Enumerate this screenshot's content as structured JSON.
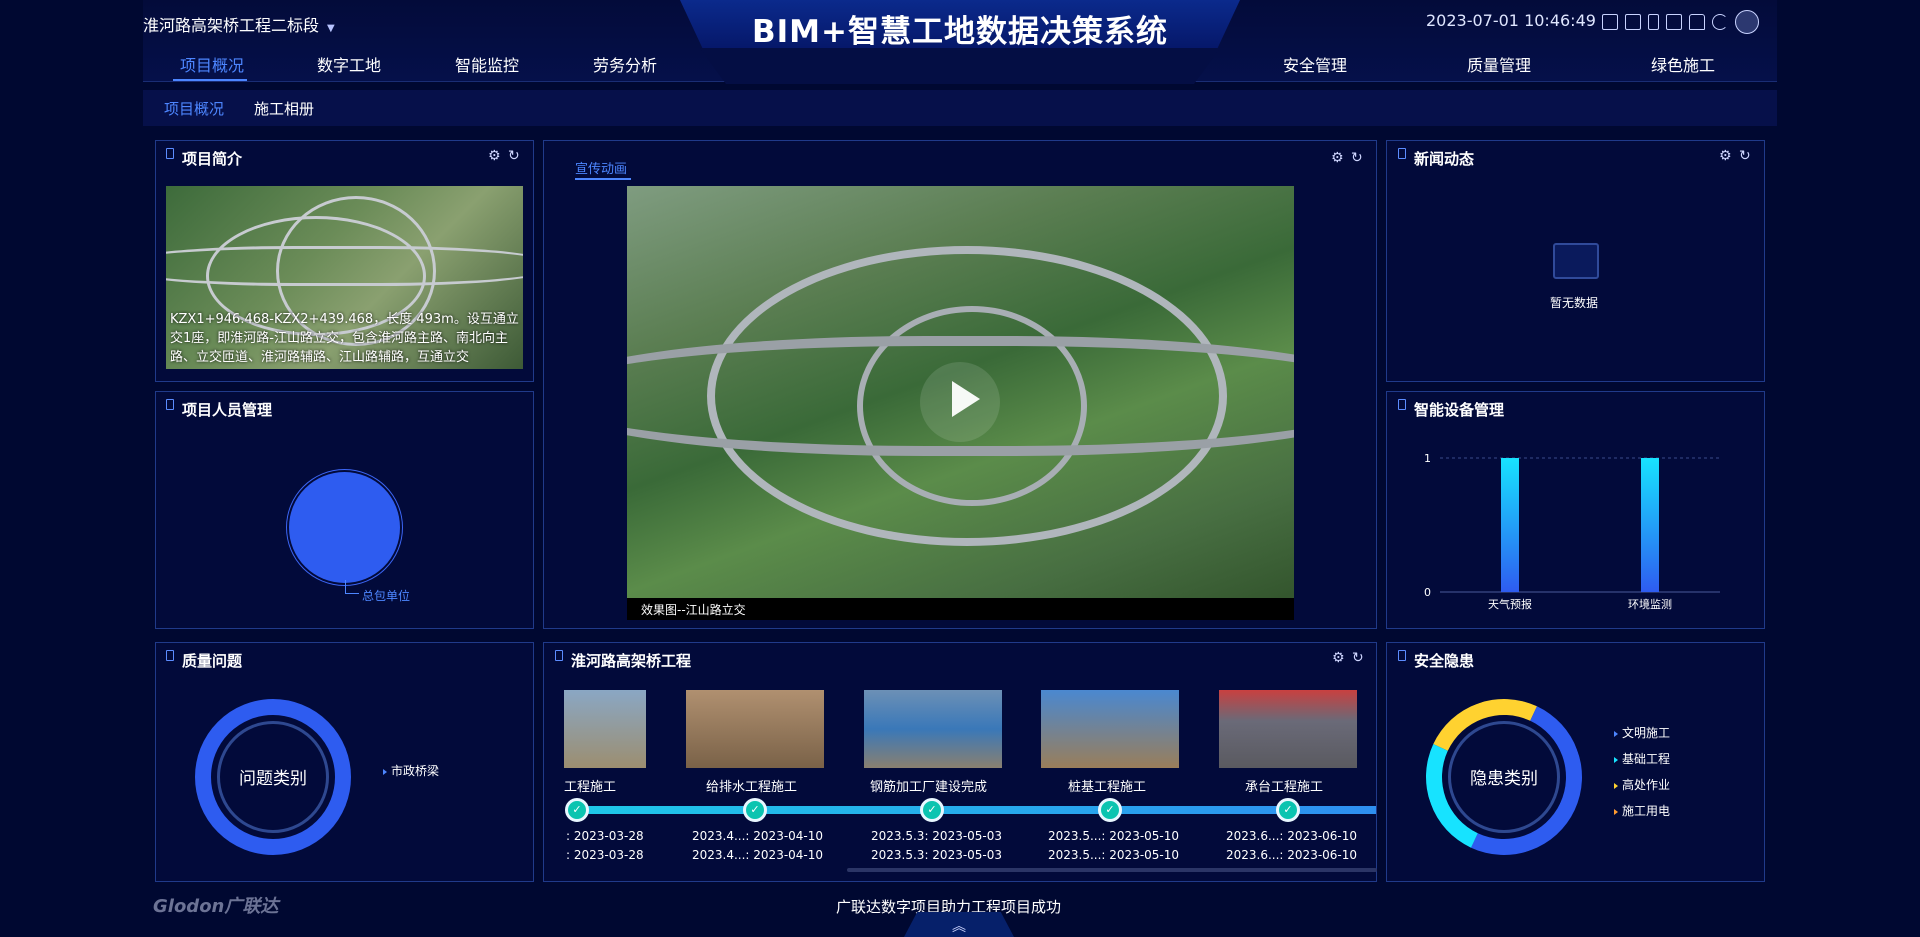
{
  "header": {
    "project_selector": "淮河路高架桥工程二标段",
    "title": "BIM+智慧工地数据决策系统",
    "datetime": "2023-07-01 10:46:49",
    "icons": [
      "grid-icon",
      "screen-icon",
      "phone-icon",
      "monitor-icon",
      "shirt-icon",
      "refresh-icon",
      "user-avatar-icon"
    ]
  },
  "nav": {
    "left": [
      "项目概况",
      "数字工地",
      "智能监控",
      "劳务分析"
    ],
    "right": [
      "安全管理",
      "质量管理",
      "绿色施工"
    ],
    "active": "项目概况"
  },
  "subnav": [
    "项目概况",
    "施工相册"
  ],
  "panels": {
    "intro": {
      "title": "项目简介",
      "text": "KZX1+946.468-KZX2+439.468，长度 493m。设互通立交1座，即淮河路-江山路立交，包含淮河路主路、南北向主路、立交匝道、淮河路辅路、江山路辅路，互通立交"
    },
    "personnel": {
      "title": "项目人员管理",
      "label": "总包单位"
    },
    "video": {
      "tab": "宣传动画",
      "caption": "效果图--江山路立交"
    },
    "news": {
      "title": "新闻动态",
      "empty": "暂无数据"
    },
    "devices": {
      "title": "智能设备管理",
      "chart_data": {
        "type": "bar",
        "categories": [
          "天气预报",
          "环境监测"
        ],
        "values": [
          1,
          1
        ],
        "ylim": [
          0,
          1
        ],
        "yticks": [
          "0",
          "1"
        ]
      }
    },
    "quality": {
      "title": "质量问题",
      "center": "问题类别",
      "legend": [
        "市政桥梁"
      ]
    },
    "timeline": {
      "title": "淮河路高架桥工程",
      "items": [
        {
          "label": "工程施工",
          "date1": ": 2023-03-28",
          "date2": ": 2023-03-28"
        },
        {
          "label": "给排水工程施工",
          "date1": "2023.4...: 2023-04-10",
          "date2": "2023.4...: 2023-04-10"
        },
        {
          "label": "钢筋加工厂建设完成",
          "date1": "2023.5.3: 2023-05-03",
          "date2": "2023.5.3: 2023-05-03"
        },
        {
          "label": "桩基工程施工",
          "date1": "2023.5...: 2023-05-10",
          "date2": "2023.5...: 2023-05-10"
        },
        {
          "label": "承台工程施工",
          "date1": "2023.6...: 2023-06-10",
          "date2": "2023.6...: 2023-06-10"
        }
      ]
    },
    "safety": {
      "title": "安全隐患",
      "center": "隐患类别",
      "legend": [
        "文明施工",
        "基础工程",
        "高处作业",
        "施工用电"
      ]
    }
  },
  "footer": {
    "logo": "Glodon广联达",
    "slogan": "广联达数字项目助力工程项目成功",
    "expand": "︽"
  },
  "colors": {
    "accent": "#4d86ff",
    "bg": "#000831",
    "bar_top": "#17e3ff",
    "bar_bottom": "#2e5cf0"
  }
}
